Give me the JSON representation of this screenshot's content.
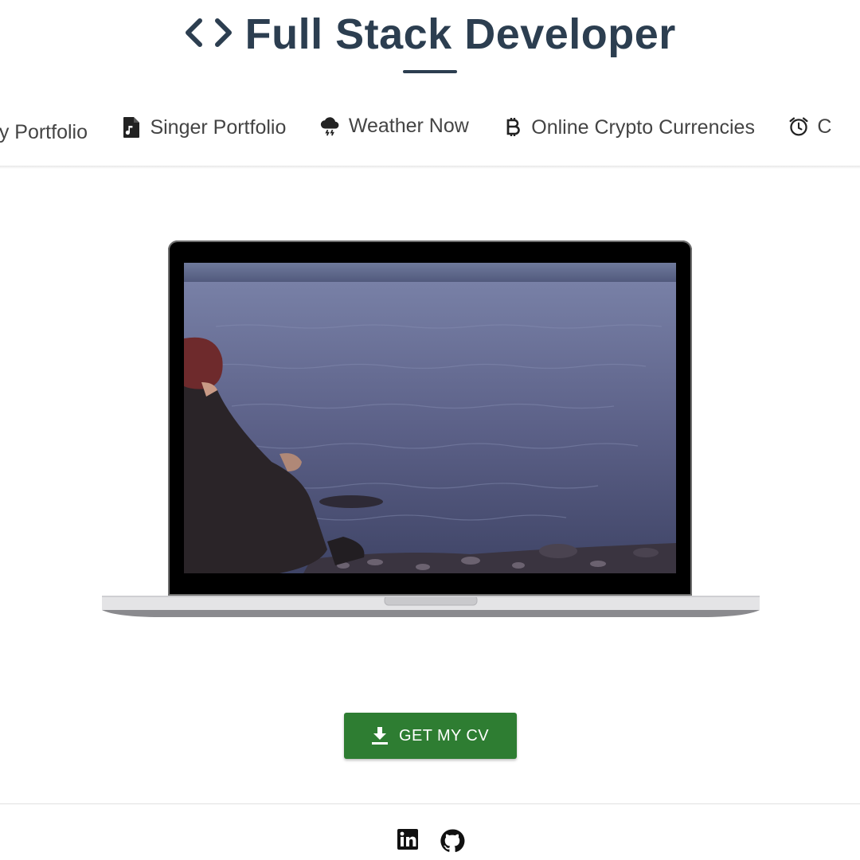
{
  "header": {
    "title": "Full Stack Developer",
    "code_icon": "code-brackets-icon",
    "accent": "#2c3e50"
  },
  "nav": {
    "items": [
      {
        "label": "My Portfolio",
        "icon": "portfolio-icon"
      },
      {
        "label": "Singer Portfolio",
        "icon": "music-file-icon"
      },
      {
        "label": "Weather Now",
        "icon": "storm-cloud-icon"
      },
      {
        "label": "Online Crypto Currencies",
        "icon": "bitcoin-icon"
      },
      {
        "label": "C",
        "icon": "alarm-clock-icon"
      }
    ]
  },
  "hero": {
    "media": "laptop-video",
    "screen_scene": "person sitting by water at dusk"
  },
  "cta": {
    "label": "GET MY CV",
    "icon": "download-icon",
    "color": "#2e7d32"
  },
  "footer": {
    "social": [
      {
        "name": "linkedin",
        "icon": "linkedin-icon"
      },
      {
        "name": "github",
        "icon": "github-icon"
      }
    ]
  }
}
